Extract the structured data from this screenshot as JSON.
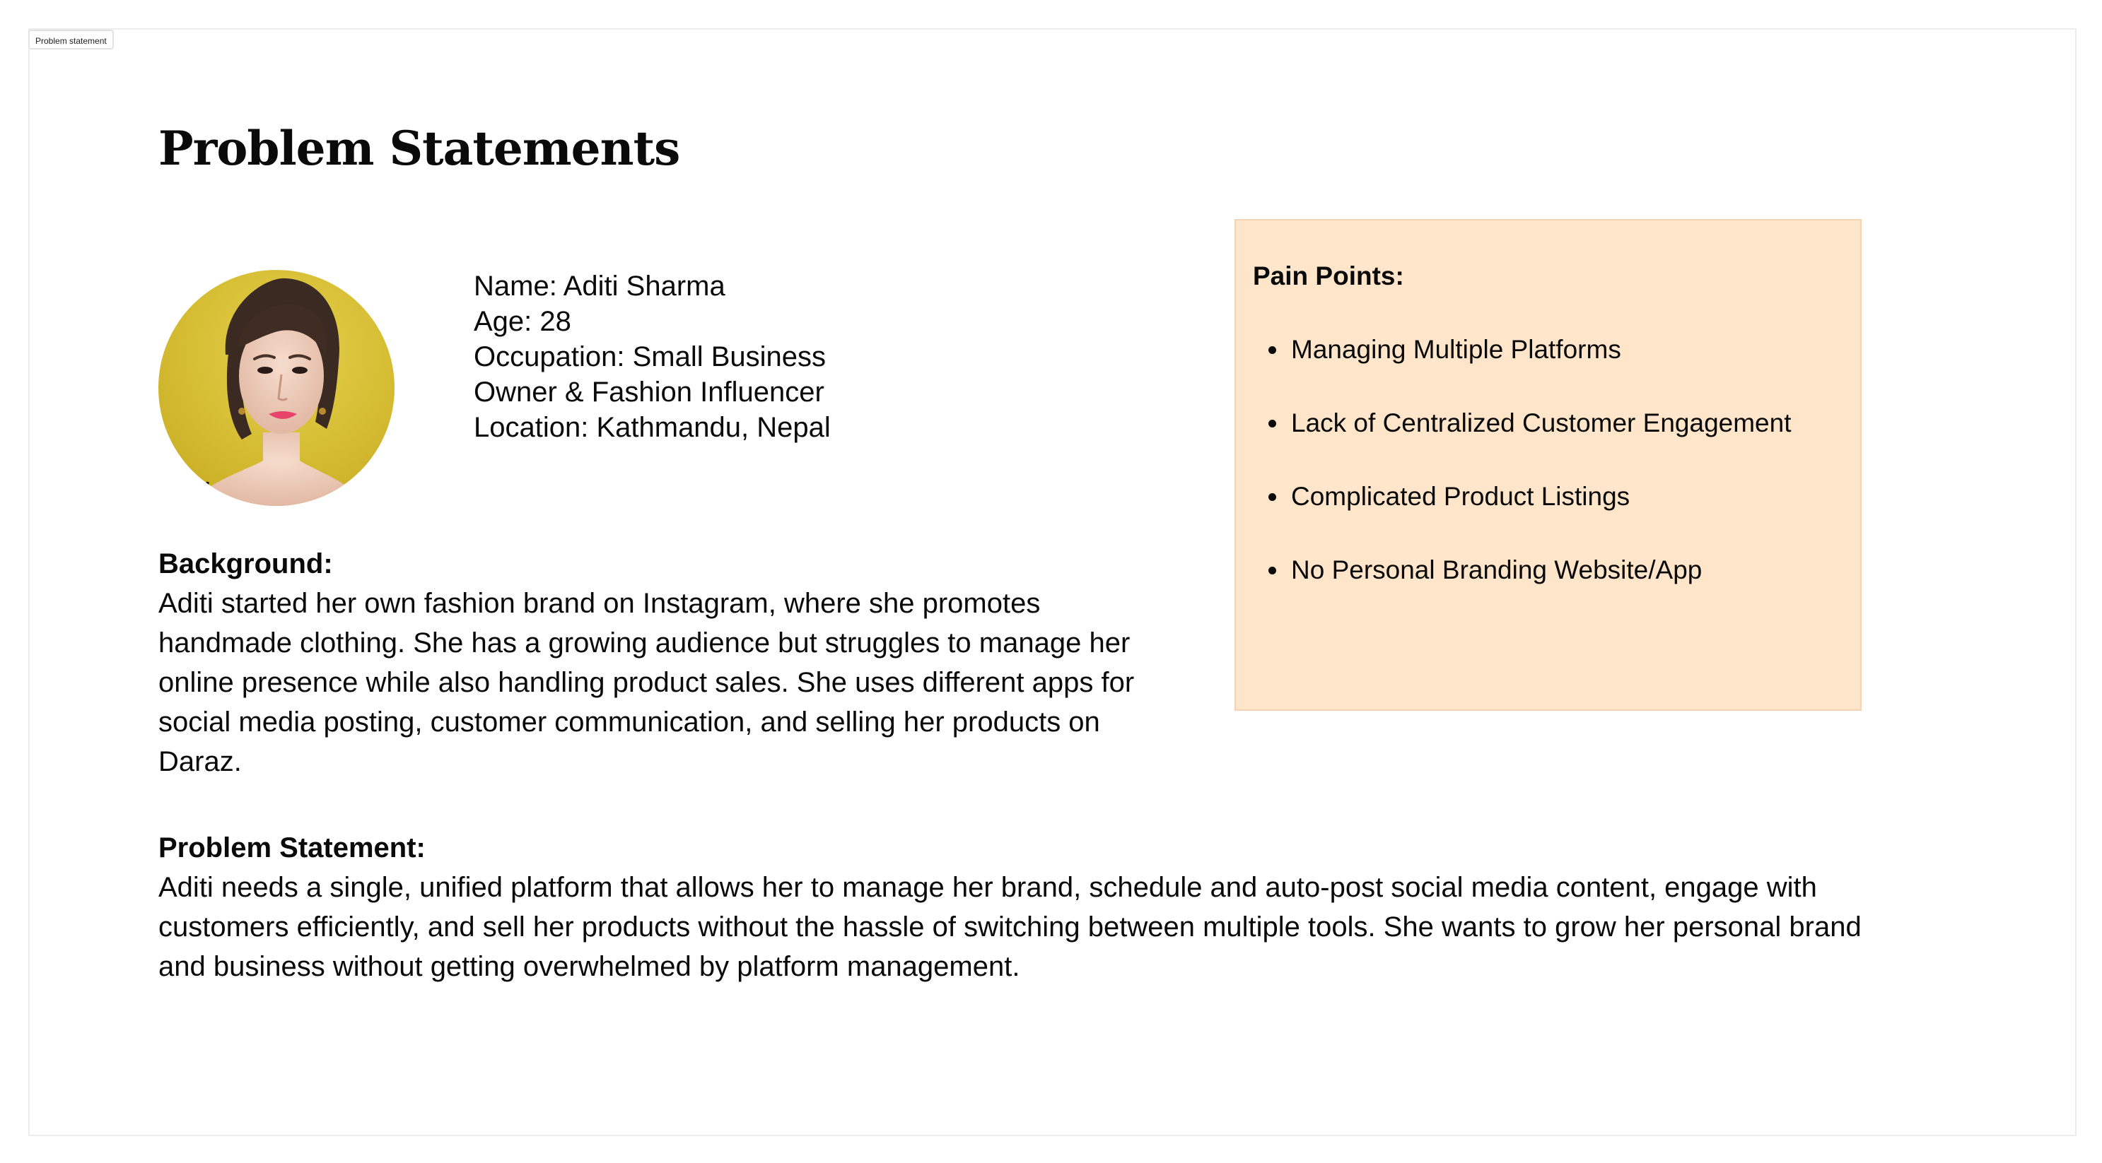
{
  "frame": {
    "label": "Problem statement"
  },
  "page": {
    "title": "Problem Statements"
  },
  "persona": {
    "avatar_icon": "person-portrait",
    "name": "Name: Aditi Sharma",
    "age": "Age: 28",
    "occupation_line1": "Occupation: Small Business",
    "occupation_line2": "Owner & Fashion Influencer",
    "location": "Location: Kathmandu, Nepal"
  },
  "background": {
    "heading": "Background:",
    "text": "Aditi started her own fashion brand on Instagram, where she promotes handmade clothing. She has a growing audience but struggles to manage her online presence while also handling product sales. She uses different apps for social media posting, customer communication, and selling her products on Daraz."
  },
  "problem": {
    "heading": "Problem Statement:",
    "text": "Aditi needs a single, unified platform that allows her to manage her brand, schedule and auto-post social media content, engage with customers efficiently, and sell her products without the hassle of switching between multiple tools. She wants to grow her personal brand and business without getting overwhelmed by platform management."
  },
  "pain_points": {
    "title": "Pain Points:",
    "items": [
      "Managing Multiple Platforms",
      "Lack of Centralized Customer Engagement",
      "Complicated Product Listings",
      "No Personal Branding Website/App"
    ],
    "card_color": "#ffe5c9"
  },
  "colors": {
    "avatar_background": "#d9c23a"
  }
}
